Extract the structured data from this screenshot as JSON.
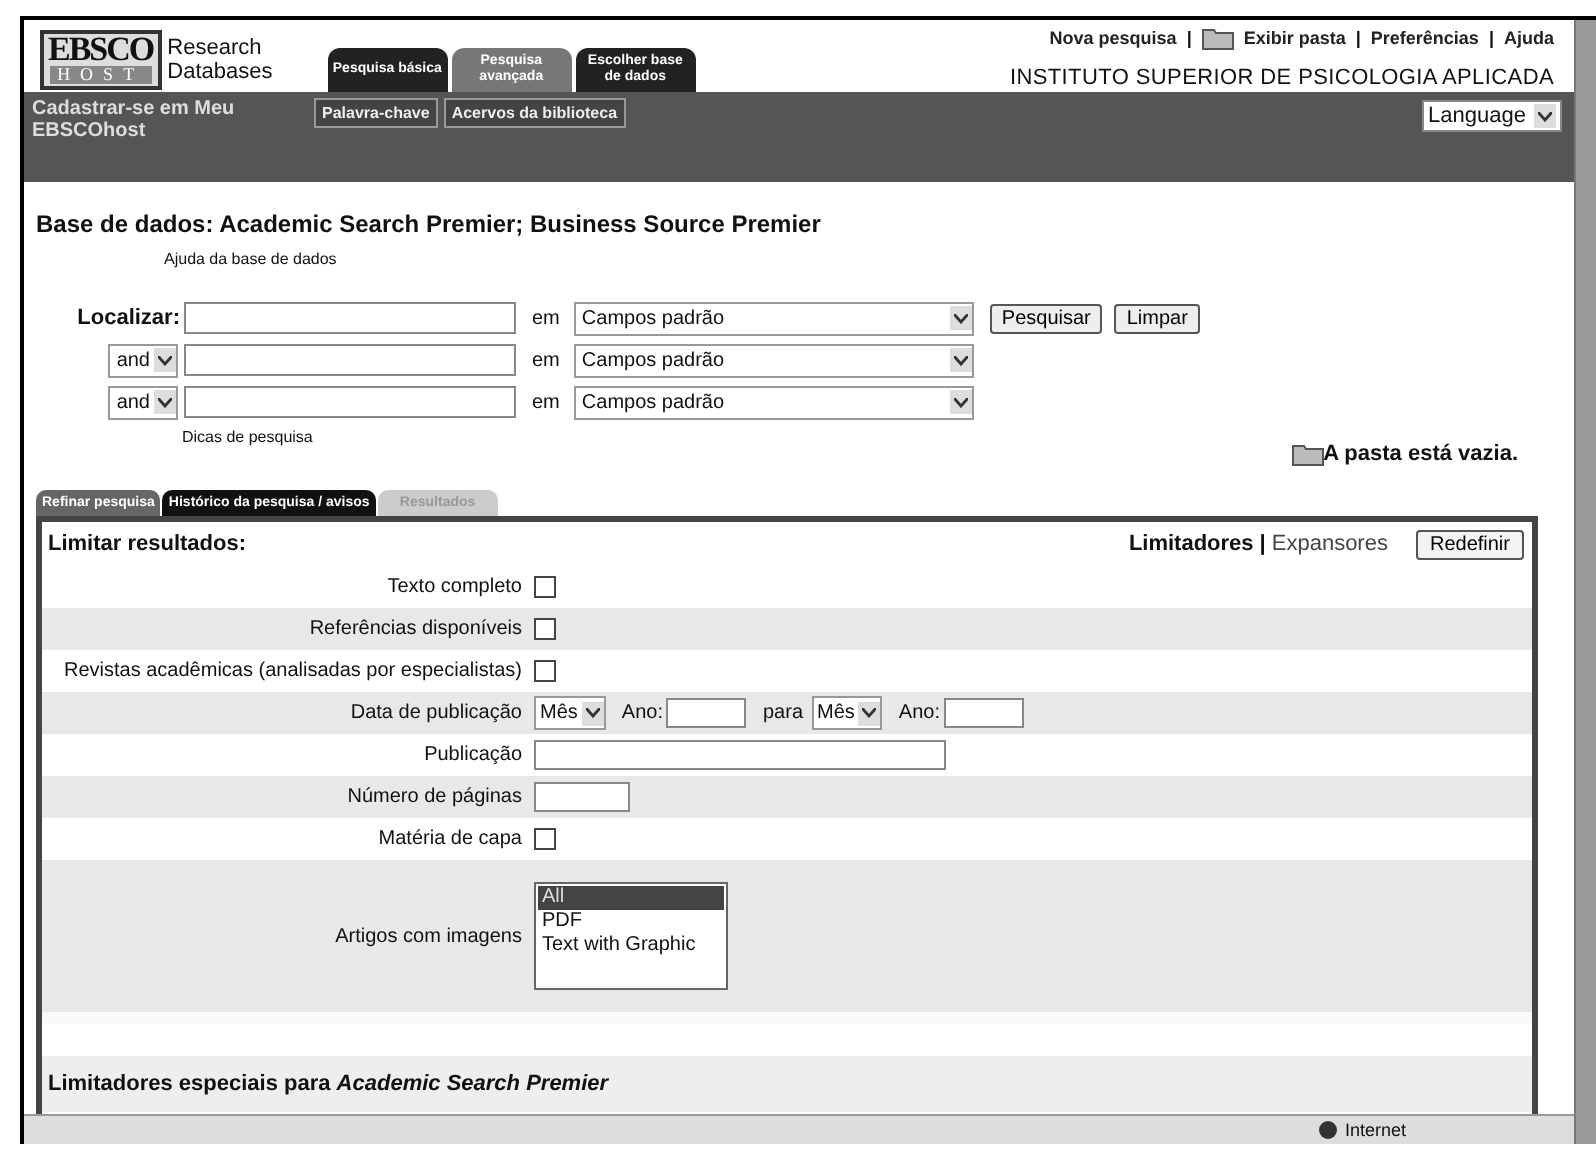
{
  "logo": {
    "brand": "EBSCO",
    "sub": "HOST",
    "tagline": "Research Databases"
  },
  "top_tabs": [
    {
      "label": "Pesquisa básica",
      "selected": false
    },
    {
      "label": "Pesquisa avançada",
      "selected": true
    },
    {
      "label": "Escolher base de dados",
      "selected": false
    }
  ],
  "top_links": {
    "items": [
      {
        "label": "Nova pesquisa",
        "kind": "text"
      },
      {
        "label": "Exibir pasta",
        "kind": "folder"
      },
      {
        "label": "Preferências",
        "kind": "text"
      },
      {
        "label": "Ajuda",
        "kind": "text"
      }
    ],
    "separator": "|"
  },
  "institution": "INSTITUTO SUPERIOR DE PSICOLOGIA APLICADA",
  "nav": {
    "signin": "Cadastrar-se em Meu EBSCOhost",
    "subtabs": [
      "Palavra-chave",
      "Acervos da biblioteca"
    ],
    "language": "Language"
  },
  "database_heading": "Base de dados: Academic Search Premier; Business Source Premier",
  "database_help": "Ajuda da base de dados",
  "search_rows": [
    {
      "kind": "find",
      "label": "Localizar:",
      "connector": "em",
      "field": "Campos padrão"
    },
    {
      "kind": "bool",
      "operator": "and",
      "connector": "em",
      "field": "Campos padrão"
    },
    {
      "kind": "bool",
      "operator": "and",
      "connector": "em",
      "field": "Campos padrão"
    }
  ],
  "search_buttons": [
    "Pesquisar",
    "Limpar"
  ],
  "search_tips": "Dicas de pesquisa",
  "folder_status": "A pasta está vazia.",
  "lower_tabs": [
    {
      "label": "Refinar pesquisa",
      "selected": true,
      "disabled": false
    },
    {
      "label": "Histórico da pesquisa / avisos",
      "selected": false,
      "disabled": false
    },
    {
      "label": "Resultados",
      "selected": false,
      "disabled": true
    }
  ],
  "panel": {
    "title": "Limitar resultados:",
    "modes": [
      {
        "label": "Limitadores",
        "selected": true
      },
      {
        "label": "Expansores",
        "selected": false
      }
    ],
    "mode_separator": "|",
    "reset": "Redefinir",
    "rows": [
      {
        "kind": "checkbox",
        "label": "Texto completo",
        "checked": false
      },
      {
        "kind": "checkbox",
        "label": "Referências disponíveis",
        "checked": false
      },
      {
        "kind": "checkbox",
        "label": "Revistas acadêmicas (analisadas por especialistas)",
        "checked": false
      },
      {
        "kind": "date",
        "label": "Data de publicação",
        "month": "Mês",
        "year_label": "Ano:",
        "to": "para",
        "month2": "Mês",
        "year_label2": "Ano:"
      },
      {
        "kind": "text",
        "label": "Publicação"
      },
      {
        "kind": "number",
        "label": "Número de páginas"
      },
      {
        "kind": "checkbox",
        "label": "Matéria de capa",
        "checked": false
      },
      {
        "kind": "listbox",
        "label": "Artigos com imagens",
        "options": [
          {
            "label": "All",
            "selected": true
          },
          {
            "label": "PDF",
            "selected": false
          },
          {
            "label": "Text with Graphic",
            "selected": false
          }
        ]
      }
    ],
    "special": "Limitadores especiais para *Academic Search Premier*"
  },
  "status_bar": {
    "zone": "Internet"
  }
}
